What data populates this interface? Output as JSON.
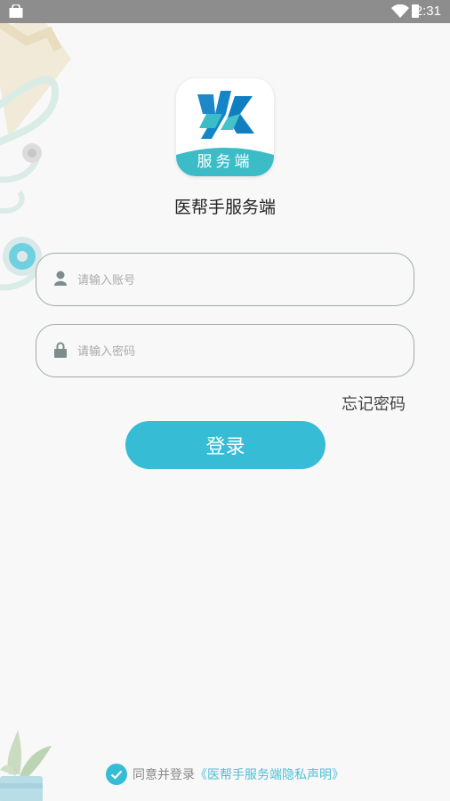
{
  "status_bar": {
    "time": "2:31"
  },
  "logo": {
    "band_text": "服务端"
  },
  "app": {
    "name": "医帮手服务端"
  },
  "account": {
    "placeholder": "请输入账号",
    "value": ""
  },
  "password": {
    "placeholder": "请输入密码",
    "value": ""
  },
  "links": {
    "forgot_password": "忘记密码"
  },
  "login": {
    "label": "登录"
  },
  "agreement": {
    "prefix": "同意并登录",
    "policy_link": "《医帮手服务端隐私声明》",
    "checked": true
  },
  "icons": {
    "status_left": "shopping-bag-icon",
    "wifi": "wifi-icon",
    "battery": "battery-icon",
    "account": "user-icon",
    "password": "lock-icon",
    "agree": "check-circle-icon"
  },
  "colors": {
    "accent": "#36bcd4",
    "logo_blue": "#0f85c9",
    "logo_teal": "#3bbcc6",
    "status_bar": "#8d8d8d",
    "link": "#4ec0d6"
  }
}
